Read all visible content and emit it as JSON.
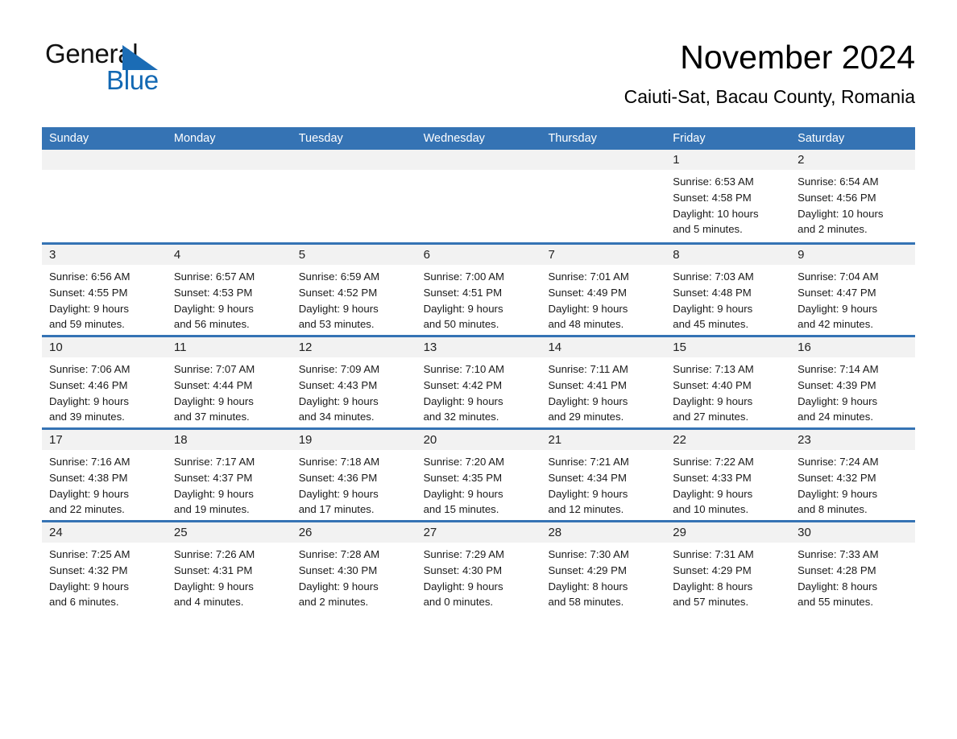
{
  "brand": {
    "name_part1": "General",
    "name_part2": "Blue",
    "triangle_color": "#1b6cb5",
    "blue_text_color": "#1268b3"
  },
  "header": {
    "month_title": "November 2024",
    "location": "Caiuti-Sat, Bacau County, Romania"
  },
  "theme": {
    "header_blue": "#3573b4",
    "daynum_band": "#f2f2f2",
    "text": "#1a1a1a"
  },
  "weekdays": [
    "Sunday",
    "Monday",
    "Tuesday",
    "Wednesday",
    "Thursday",
    "Friday",
    "Saturday"
  ],
  "weeks": [
    [
      {
        "day": "",
        "empty": true,
        "sunrise": "",
        "sunset": "",
        "daylight_line1": "",
        "daylight_line2": ""
      },
      {
        "day": "",
        "empty": true,
        "sunrise": "",
        "sunset": "",
        "daylight_line1": "",
        "daylight_line2": ""
      },
      {
        "day": "",
        "empty": true,
        "sunrise": "",
        "sunset": "",
        "daylight_line1": "",
        "daylight_line2": ""
      },
      {
        "day": "",
        "empty": true,
        "sunrise": "",
        "sunset": "",
        "daylight_line1": "",
        "daylight_line2": ""
      },
      {
        "day": "",
        "empty": true,
        "sunrise": "",
        "sunset": "",
        "daylight_line1": "",
        "daylight_line2": ""
      },
      {
        "day": "1",
        "empty": false,
        "sunrise": "Sunrise: 6:53 AM",
        "sunset": "Sunset: 4:58 PM",
        "daylight_line1": "Daylight: 10 hours",
        "daylight_line2": "and 5 minutes."
      },
      {
        "day": "2",
        "empty": false,
        "sunrise": "Sunrise: 6:54 AM",
        "sunset": "Sunset: 4:56 PM",
        "daylight_line1": "Daylight: 10 hours",
        "daylight_line2": "and 2 minutes."
      }
    ],
    [
      {
        "day": "3",
        "empty": false,
        "sunrise": "Sunrise: 6:56 AM",
        "sunset": "Sunset: 4:55 PM",
        "daylight_line1": "Daylight: 9 hours",
        "daylight_line2": "and 59 minutes."
      },
      {
        "day": "4",
        "empty": false,
        "sunrise": "Sunrise: 6:57 AM",
        "sunset": "Sunset: 4:53 PM",
        "daylight_line1": "Daylight: 9 hours",
        "daylight_line2": "and 56 minutes."
      },
      {
        "day": "5",
        "empty": false,
        "sunrise": "Sunrise: 6:59 AM",
        "sunset": "Sunset: 4:52 PM",
        "daylight_line1": "Daylight: 9 hours",
        "daylight_line2": "and 53 minutes."
      },
      {
        "day": "6",
        "empty": false,
        "sunrise": "Sunrise: 7:00 AM",
        "sunset": "Sunset: 4:51 PM",
        "daylight_line1": "Daylight: 9 hours",
        "daylight_line2": "and 50 minutes."
      },
      {
        "day": "7",
        "empty": false,
        "sunrise": "Sunrise: 7:01 AM",
        "sunset": "Sunset: 4:49 PM",
        "daylight_line1": "Daylight: 9 hours",
        "daylight_line2": "and 48 minutes."
      },
      {
        "day": "8",
        "empty": false,
        "sunrise": "Sunrise: 7:03 AM",
        "sunset": "Sunset: 4:48 PM",
        "daylight_line1": "Daylight: 9 hours",
        "daylight_line2": "and 45 minutes."
      },
      {
        "day": "9",
        "empty": false,
        "sunrise": "Sunrise: 7:04 AM",
        "sunset": "Sunset: 4:47 PM",
        "daylight_line1": "Daylight: 9 hours",
        "daylight_line2": "and 42 minutes."
      }
    ],
    [
      {
        "day": "10",
        "empty": false,
        "sunrise": "Sunrise: 7:06 AM",
        "sunset": "Sunset: 4:46 PM",
        "daylight_line1": "Daylight: 9 hours",
        "daylight_line2": "and 39 minutes."
      },
      {
        "day": "11",
        "empty": false,
        "sunrise": "Sunrise: 7:07 AM",
        "sunset": "Sunset: 4:44 PM",
        "daylight_line1": "Daylight: 9 hours",
        "daylight_line2": "and 37 minutes."
      },
      {
        "day": "12",
        "empty": false,
        "sunrise": "Sunrise: 7:09 AM",
        "sunset": "Sunset: 4:43 PM",
        "daylight_line1": "Daylight: 9 hours",
        "daylight_line2": "and 34 minutes."
      },
      {
        "day": "13",
        "empty": false,
        "sunrise": "Sunrise: 7:10 AM",
        "sunset": "Sunset: 4:42 PM",
        "daylight_line1": "Daylight: 9 hours",
        "daylight_line2": "and 32 minutes."
      },
      {
        "day": "14",
        "empty": false,
        "sunrise": "Sunrise: 7:11 AM",
        "sunset": "Sunset: 4:41 PM",
        "daylight_line1": "Daylight: 9 hours",
        "daylight_line2": "and 29 minutes."
      },
      {
        "day": "15",
        "empty": false,
        "sunrise": "Sunrise: 7:13 AM",
        "sunset": "Sunset: 4:40 PM",
        "daylight_line1": "Daylight: 9 hours",
        "daylight_line2": "and 27 minutes."
      },
      {
        "day": "16",
        "empty": false,
        "sunrise": "Sunrise: 7:14 AM",
        "sunset": "Sunset: 4:39 PM",
        "daylight_line1": "Daylight: 9 hours",
        "daylight_line2": "and 24 minutes."
      }
    ],
    [
      {
        "day": "17",
        "empty": false,
        "sunrise": "Sunrise: 7:16 AM",
        "sunset": "Sunset: 4:38 PM",
        "daylight_line1": "Daylight: 9 hours",
        "daylight_line2": "and 22 minutes."
      },
      {
        "day": "18",
        "empty": false,
        "sunrise": "Sunrise: 7:17 AM",
        "sunset": "Sunset: 4:37 PM",
        "daylight_line1": "Daylight: 9 hours",
        "daylight_line2": "and 19 minutes."
      },
      {
        "day": "19",
        "empty": false,
        "sunrise": "Sunrise: 7:18 AM",
        "sunset": "Sunset: 4:36 PM",
        "daylight_line1": "Daylight: 9 hours",
        "daylight_line2": "and 17 minutes."
      },
      {
        "day": "20",
        "empty": false,
        "sunrise": "Sunrise: 7:20 AM",
        "sunset": "Sunset: 4:35 PM",
        "daylight_line1": "Daylight: 9 hours",
        "daylight_line2": "and 15 minutes."
      },
      {
        "day": "21",
        "empty": false,
        "sunrise": "Sunrise: 7:21 AM",
        "sunset": "Sunset: 4:34 PM",
        "daylight_line1": "Daylight: 9 hours",
        "daylight_line2": "and 12 minutes."
      },
      {
        "day": "22",
        "empty": false,
        "sunrise": "Sunrise: 7:22 AM",
        "sunset": "Sunset: 4:33 PM",
        "daylight_line1": "Daylight: 9 hours",
        "daylight_line2": "and 10 minutes."
      },
      {
        "day": "23",
        "empty": false,
        "sunrise": "Sunrise: 7:24 AM",
        "sunset": "Sunset: 4:32 PM",
        "daylight_line1": "Daylight: 9 hours",
        "daylight_line2": "and 8 minutes."
      }
    ],
    [
      {
        "day": "24",
        "empty": false,
        "sunrise": "Sunrise: 7:25 AM",
        "sunset": "Sunset: 4:32 PM",
        "daylight_line1": "Daylight: 9 hours",
        "daylight_line2": "and 6 minutes."
      },
      {
        "day": "25",
        "empty": false,
        "sunrise": "Sunrise: 7:26 AM",
        "sunset": "Sunset: 4:31 PM",
        "daylight_line1": "Daylight: 9 hours",
        "daylight_line2": "and 4 minutes."
      },
      {
        "day": "26",
        "empty": false,
        "sunrise": "Sunrise: 7:28 AM",
        "sunset": "Sunset: 4:30 PM",
        "daylight_line1": "Daylight: 9 hours",
        "daylight_line2": "and 2 minutes."
      },
      {
        "day": "27",
        "empty": false,
        "sunrise": "Sunrise: 7:29 AM",
        "sunset": "Sunset: 4:30 PM",
        "daylight_line1": "Daylight: 9 hours",
        "daylight_line2": "and 0 minutes."
      },
      {
        "day": "28",
        "empty": false,
        "sunrise": "Sunrise: 7:30 AM",
        "sunset": "Sunset: 4:29 PM",
        "daylight_line1": "Daylight: 8 hours",
        "daylight_line2": "and 58 minutes."
      },
      {
        "day": "29",
        "empty": false,
        "sunrise": "Sunrise: 7:31 AM",
        "sunset": "Sunset: 4:29 PM",
        "daylight_line1": "Daylight: 8 hours",
        "daylight_line2": "and 57 minutes."
      },
      {
        "day": "30",
        "empty": false,
        "sunrise": "Sunrise: 7:33 AM",
        "sunset": "Sunset: 4:28 PM",
        "daylight_line1": "Daylight: 8 hours",
        "daylight_line2": "and 55 minutes."
      }
    ]
  ]
}
